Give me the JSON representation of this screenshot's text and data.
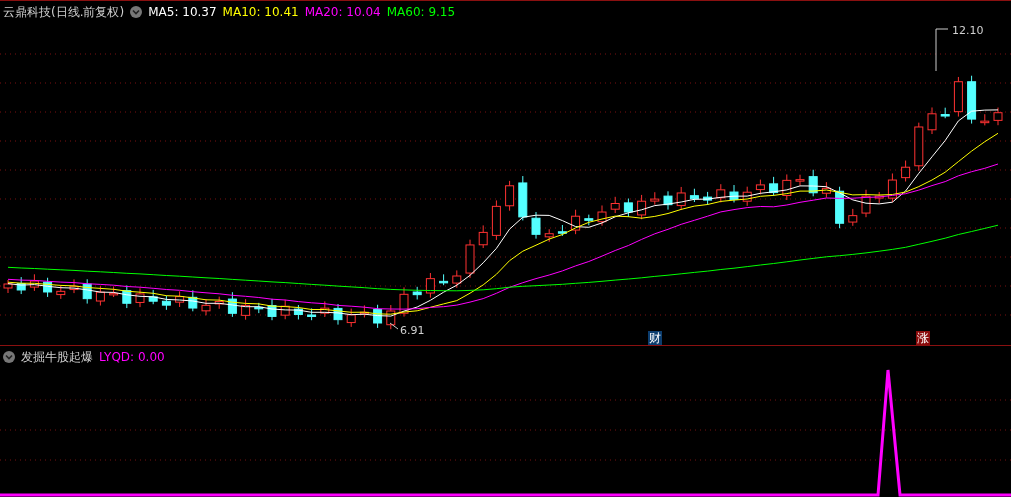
{
  "main_panel": {
    "title": "云鼎科技(日线.前复权)",
    "legend": [
      {
        "label": "MA5: 10.37",
        "color": "#ffffff"
      },
      {
        "label": "MA10: 10.41",
        "color": "#ffff00"
      },
      {
        "label": "MA20: 10.04",
        "color": "#ff00ff"
      },
      {
        "label": "MA60: 9.15",
        "color": "#00ff00"
      }
    ],
    "high_marker": "12.10",
    "low_marker": "6.91",
    "events": [
      {
        "label": "财",
        "color": "#0c3d6e"
      },
      {
        "label": "涨",
        "color": "#8a0a0a"
      }
    ]
  },
  "indicator_panel": {
    "title": "发掘牛股起爆",
    "reading": "LYQD: 0.00"
  }
}
